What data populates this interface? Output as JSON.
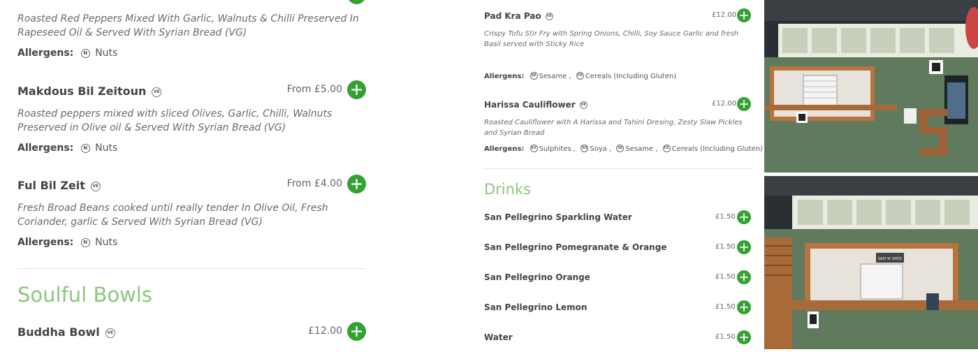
{
  "left": {
    "top_item": {
      "description": "Roasted Red Peppers Mixed With Garlic, Walnuts & Chilli Preserved In Rapeseed Oil & Served With Syrian Bread (VG)",
      "allergens_label": "Allergens:",
      "allergens": [
        {
          "code": "N",
          "name": "Nuts"
        }
      ]
    },
    "items": [
      {
        "title": "Makdous Bil Zeitoun",
        "badge": "VE",
        "price": "From £5.00",
        "description": "Roasted peppers mixed with sliced Olives, Garlic, Chilli, Walnuts Preserved in Olive oil & Served With Syrian Bread (VG)",
        "allergens_label": "Allergens:",
        "allergens": [
          {
            "code": "N",
            "name": "Nuts"
          }
        ]
      },
      {
        "title": "Ful Bil Zeit",
        "badge": "VE",
        "price": "From £4.00",
        "description": "Fresh Broad Beans cooked until really tender In Olive Oil, Fresh Coriander, garlic & Served With Syrian Bread (VG)",
        "allergens_label": "Allergens:",
        "allergens": [
          {
            "code": "N",
            "name": "Nuts"
          }
        ]
      }
    ],
    "section_title": "Soulful Bowls",
    "bowl": {
      "title": "Buddha Bowl",
      "badge": "VE",
      "price": "£12.00"
    }
  },
  "middle": {
    "items": [
      {
        "title": "Pad Kra Pao",
        "badge": "VE",
        "price": "£12.00",
        "description": "Crispy Tofu Stir Fry with Spring Onions, Chilli, Soy Sauce Garlic and fresh Basil served with Sticky Rice",
        "allergens_label": "Allergens:",
        "allergens": [
          {
            "code": "SE",
            "name": "Sesame ,"
          },
          {
            "code": "CE",
            "name": "Cereals (Including Gluten)"
          }
        ]
      },
      {
        "title": "Harissa Cauliflower",
        "badge": "VE",
        "price": "£12.00",
        "description": "Roasted Cauliflower with A Harissa and Tahini Dresing, Zesty Slaw Pickles and Syrian Bread",
        "allergens_label": "Allergens:",
        "allergens": [
          {
            "code": "SU",
            "name": "Sulphites ,"
          },
          {
            "code": "SO",
            "name": "Soya ,"
          },
          {
            "code": "SE",
            "name": "Sesame ,"
          },
          {
            "code": "CE",
            "name": "Cereals (Including Gluten)"
          }
        ]
      }
    ],
    "section_title": "Drinks",
    "drinks": [
      {
        "title": "San Pellegrino Sparkling Water",
        "price": "£1.50"
      },
      {
        "title": "San Pellegrino Pomegranate & Orange",
        "price": "£1.50"
      },
      {
        "title": "San Pellegrino Orange",
        "price": "£1.50"
      },
      {
        "title": "San Pellegrino Lemon",
        "price": "£1.50"
      },
      {
        "title": "Water",
        "price": "£1.50"
      }
    ]
  },
  "icons": {
    "add": "plus-icon",
    "vegan": "vegan-badge-icon",
    "allergen": "allergen-badge-icon"
  },
  "colors": {
    "accent_green": "#33a233",
    "section_title": "#8cc77d",
    "wall_green": "#5f7a5d",
    "wood": "#b8743f"
  },
  "photos": [
    {
      "sign_text": ""
    },
    {
      "sign_text": "SALT N' SPICE"
    }
  ]
}
